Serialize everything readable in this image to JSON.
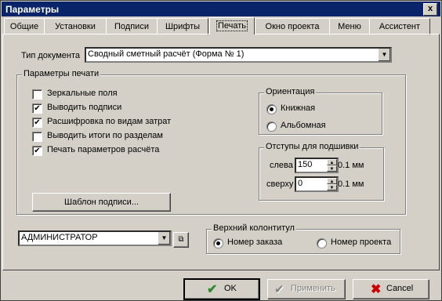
{
  "window": {
    "title": "Параметры",
    "close_label": "x"
  },
  "tabs": [
    "Общие",
    "Установки",
    "Подписи",
    "Шрифты",
    "Печать",
    "Окно проекта",
    "Меню",
    "Ассистент"
  ],
  "doc_type": {
    "label": "Тип документа",
    "value": "Сводный сметный расчёт (Форма № 1)"
  },
  "print_params": {
    "title": "Параметры печати",
    "options": [
      {
        "label": "Зеркальные поля",
        "checked": false
      },
      {
        "label": "Выводить подписи",
        "checked": true
      },
      {
        "label": "Расшифровка по видам затрат",
        "checked": true
      },
      {
        "label": "Выводить итоги по разделам",
        "checked": false
      },
      {
        "label": "Печать параметров расчёта",
        "checked": true
      }
    ],
    "template_button": "Шаблон подписи..."
  },
  "orientation": {
    "title": "Ориентация",
    "portrait": "Книжная",
    "landscape": "Альбомная",
    "selected": "portrait"
  },
  "margins": {
    "title": "Отступы для подшивки",
    "left_label": "слева",
    "left_value": "150",
    "left_unit": "0.1 мм",
    "top_label": "сверху",
    "top_value": "0",
    "top_unit": "0.1 мм"
  },
  "user": {
    "value": "АДМИНИСТРАТОР"
  },
  "header": {
    "title": "Верхний колонтитул",
    "order": "Номер заказа",
    "project": "Номер проекта",
    "selected": "order"
  },
  "buttons": {
    "ok": "OK",
    "apply": "Применить",
    "cancel": "Cancel"
  },
  "colors": {
    "titlebar": "#0a246a",
    "face": "#d4d0c8",
    "ok_check": "#2e8b2e",
    "cancel_x": "#cc0000"
  }
}
